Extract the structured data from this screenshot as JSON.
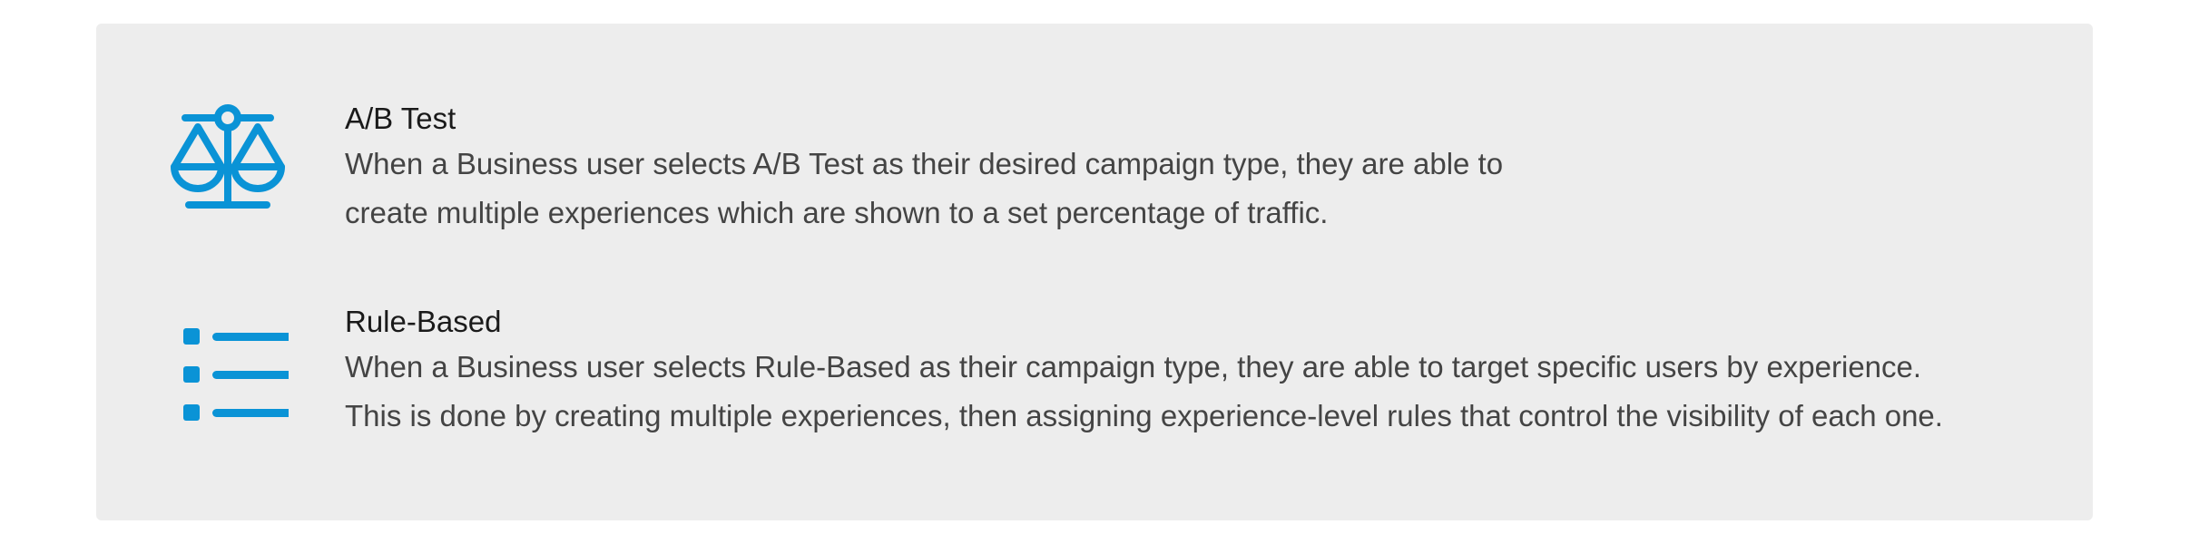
{
  "accent_color": "#0a93d6",
  "items": [
    {
      "icon": "balance-scale-icon",
      "title": "A/B Test",
      "lines": [
        "When a Business user selects A/B Test as their desired campaign type, they are able to",
        "create multiple experiences which are shown to a set percentage of traffic."
      ]
    },
    {
      "icon": "list-icon",
      "title": "Rule-Based",
      "lines": [
        "When a Business user selects Rule-Based as their campaign type, they are able to target specific users by experience.",
        "This is done by creating multiple experiences, then assigning experience-level rules that control the visibility of each one."
      ]
    }
  ]
}
